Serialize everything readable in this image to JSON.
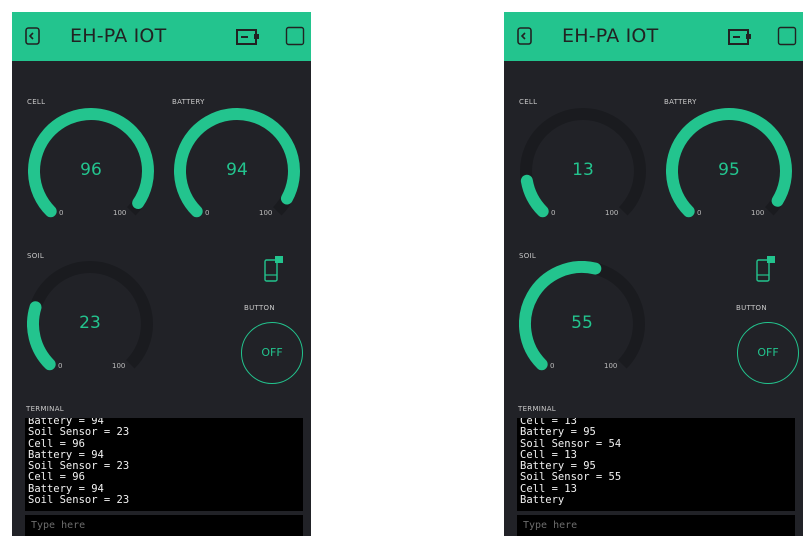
{
  "app": {
    "title": "EH-PA IOT",
    "accent": "#23c48e",
    "background": "#212227",
    "track": "#1a1b1f"
  },
  "labels": {
    "cell": "CELL",
    "battery": "BATTERY",
    "soil": "SOIL",
    "button": "BUTTON",
    "terminal": "TERMINAL"
  },
  "gauge_min": "0",
  "gauge_max": "100",
  "screens": [
    {
      "cell": {
        "value": "96"
      },
      "battery": {
        "value": "94"
      },
      "soil": {
        "value": "23"
      },
      "button_state": "OFF",
      "terminal_lines": [
        "Battery = 94",
        "Soil Sensor = 23",
        "Cell = 96",
        "Battery = 94",
        "Soil Sensor = 23",
        "Cell = 96",
        "Battery = 94",
        "Soil Sensor = 23"
      ],
      "input_placeholder": "Type here"
    },
    {
      "cell": {
        "value": "13"
      },
      "battery": {
        "value": "95"
      },
      "soil": {
        "value": "55"
      },
      "button_state": "OFF",
      "terminal_lines": [
        "Cell = 13",
        "Battery = 95",
        "Soil Sensor = 54",
        "Cell = 13",
        "Battery = 95",
        "Soil Sensor = 55",
        "Cell = 13",
        "Battery"
      ],
      "input_placeholder": "Type here"
    }
  ]
}
